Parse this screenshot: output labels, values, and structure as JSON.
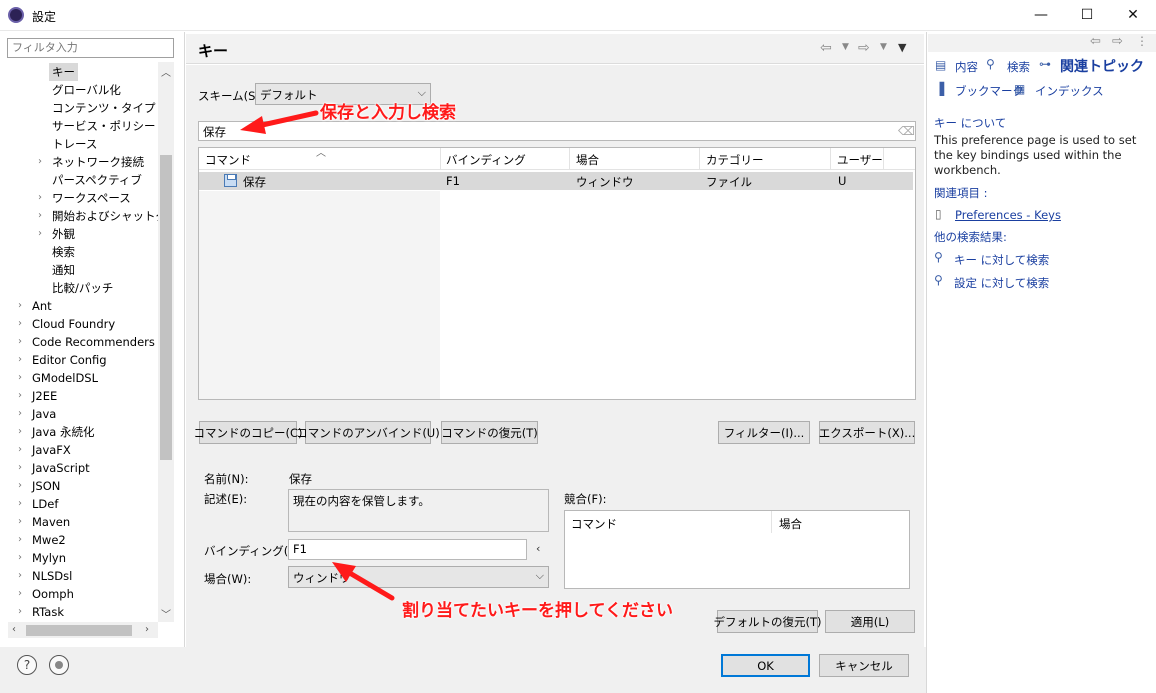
{
  "window": {
    "title": "設定",
    "minimize": "—",
    "maximize": "☐",
    "close": "✕"
  },
  "sidebar": {
    "filter_placeholder": "フィルタ入力",
    "items": [
      {
        "label": "キー",
        "selected": true,
        "indent": 1
      },
      {
        "label": "グローバル化",
        "indent": 1
      },
      {
        "label": "コンテンツ・タイプ",
        "indent": 1
      },
      {
        "label": "サービス・ポリシー",
        "indent": 1
      },
      {
        "label": "トレース",
        "indent": 1
      },
      {
        "label": "ネットワーク接続",
        "indent": 1,
        "expandable": true
      },
      {
        "label": "パースペクティブ",
        "indent": 1
      },
      {
        "label": "ワークスペース",
        "indent": 1,
        "expandable": true
      },
      {
        "label": "開始およびシャットダウン",
        "indent": 1,
        "expandable": true
      },
      {
        "label": "外観",
        "indent": 1,
        "expandable": true
      },
      {
        "label": "検索",
        "indent": 1
      },
      {
        "label": "通知",
        "indent": 1
      },
      {
        "label": "比較/パッチ",
        "indent": 1
      },
      {
        "label": "Ant",
        "indent": 0,
        "expandable": true
      },
      {
        "label": "Cloud Foundry",
        "indent": 0,
        "expandable": true
      },
      {
        "label": "Code Recommenders",
        "indent": 0,
        "expandable": true
      },
      {
        "label": "Editor Config",
        "indent": 0,
        "expandable": true
      },
      {
        "label": "GModelDSL",
        "indent": 0,
        "expandable": true
      },
      {
        "label": "J2EE",
        "indent": 0,
        "expandable": true
      },
      {
        "label": "Java",
        "indent": 0,
        "expandable": true
      },
      {
        "label": "Java 永続化",
        "indent": 0,
        "expandable": true
      },
      {
        "label": "JavaFX",
        "indent": 0,
        "expandable": true
      },
      {
        "label": "JavaScript",
        "indent": 0,
        "expandable": true
      },
      {
        "label": "JSON",
        "indent": 0,
        "expandable": true
      },
      {
        "label": "LDef",
        "indent": 0,
        "expandable": true
      },
      {
        "label": "Maven",
        "indent": 0,
        "expandable": true
      },
      {
        "label": "Mwe2",
        "indent": 0,
        "expandable": true
      },
      {
        "label": "Mylyn",
        "indent": 0,
        "expandable": true
      },
      {
        "label": "NLSDsl",
        "indent": 0,
        "expandable": true
      },
      {
        "label": "Oomph",
        "indent": 0,
        "expandable": true
      },
      {
        "label": "RTask",
        "indent": 0,
        "expandable": true
      }
    ]
  },
  "main": {
    "title": "キー",
    "scheme_label": "スキーム(S):",
    "scheme_value": "デフォルト",
    "search_value": "保存",
    "table": {
      "headers": [
        "コマンド",
        "バインディング",
        "場合",
        "カテゴリー",
        "ユーザー"
      ],
      "rows": [
        [
          "保存",
          "F1",
          "ウィンドウ",
          "ファイル",
          "U"
        ]
      ]
    },
    "buttons": {
      "copy": "コマンドのコピー(C)",
      "unbind": "コマンドのアンバインド(U)",
      "restore": "コマンドの復元(T)",
      "filter": "フィルター(I)...",
      "export": "エクスポート(X)..."
    },
    "details": {
      "name_label": "名前(N):",
      "name_value": "保存",
      "desc_label": "記述(E):",
      "desc_value": "現在の内容を保管します。",
      "binding_label": "バインディング(B):",
      "binding_value": "F1",
      "binding_arrow": "‹",
      "when_label": "場合(W):",
      "when_value": "ウィンドウ",
      "conflicts_label": "競合(F):",
      "conflicts_headers": [
        "コマンド",
        "場合"
      ]
    },
    "restore_defaults": "デフォルトの復元(T)",
    "apply": "適用(L)"
  },
  "dialog": {
    "ok": "OK",
    "cancel": "キャンセル",
    "help_icon": "?"
  },
  "help": {
    "contents": "内容",
    "search": "検索",
    "related": "関連トピック",
    "bookmarks": "ブックマーク",
    "index": "インデックス",
    "about_heading": "キー について",
    "about_text": "This preference page is used to set the key bindings used within the workbench.",
    "related_items_label": "関連項目 :",
    "preferences_keys": "Preferences - Keys",
    "other_results_label": "他の検索結果:",
    "search_key": "キー に対して検索",
    "search_settings": "設定 に対して検索"
  },
  "annotations": {
    "search_hint": "保存と入力し検索",
    "binding_hint": "割り当てたいキーを押してください"
  },
  "colors": {
    "annotation": "#ff1a1a",
    "link": "#1a3fa0",
    "accent": "#0078d7"
  }
}
